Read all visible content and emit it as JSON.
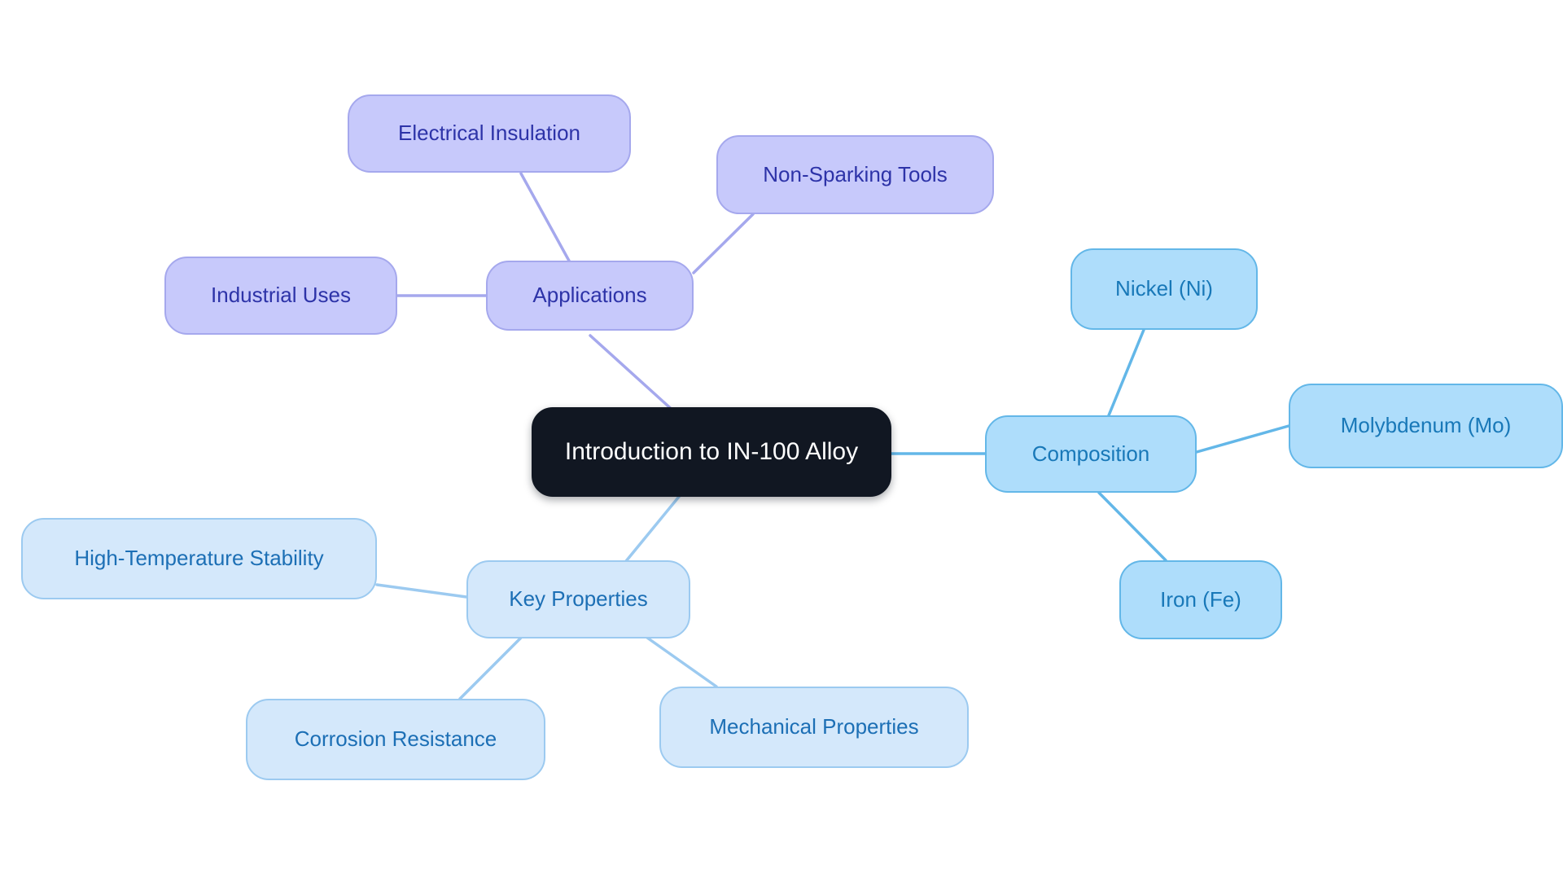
{
  "diagram": {
    "type": "mind-map",
    "title": "Introduction to IN-100 Alloy",
    "background_color": "#ffffff",
    "branch_colors": {
      "applications": "#c7c9fb",
      "composition": "#aeddfb",
      "key_properties": "#d4e8fb",
      "root": "#111722"
    }
  },
  "nodes": {
    "root": {
      "label": "Introduction to IN-100 Alloy"
    },
    "applications": {
      "label": "Applications"
    },
    "electrical_insulation": {
      "label": "Electrical Insulation"
    },
    "non_sparking_tools": {
      "label": "Non-Sparking Tools"
    },
    "industrial_uses": {
      "label": "Industrial Uses"
    },
    "composition": {
      "label": "Composition"
    },
    "nickel": {
      "label": "Nickel (Ni)"
    },
    "molybdenum": {
      "label": "Molybdenum (Mo)"
    },
    "iron": {
      "label": "Iron (Fe)"
    },
    "key_properties": {
      "label": "Key Properties"
    },
    "high_temperature_stability": {
      "label": "High-Temperature Stability"
    },
    "corrosion_resistance": {
      "label": "Corrosion Resistance"
    },
    "mechanical_properties": {
      "label": "Mechanical Properties"
    }
  },
  "edges": [
    {
      "from": "root",
      "to": "applications",
      "color": "#a5a8ed"
    },
    {
      "from": "applications",
      "to": "electrical_insulation",
      "color": "#a5a8ed"
    },
    {
      "from": "applications",
      "to": "non_sparking_tools",
      "color": "#a5a8ed"
    },
    {
      "from": "applications",
      "to": "industrial_uses",
      "color": "#a5a8ed"
    },
    {
      "from": "root",
      "to": "composition",
      "color": "#63b7e8"
    },
    {
      "from": "composition",
      "to": "nickel",
      "color": "#63b7e8"
    },
    {
      "from": "composition",
      "to": "molybdenum",
      "color": "#63b7e8"
    },
    {
      "from": "composition",
      "to": "iron",
      "color": "#63b7e8"
    },
    {
      "from": "root",
      "to": "key_properties",
      "color": "#9ccaf0"
    },
    {
      "from": "key_properties",
      "to": "high_temperature_stability",
      "color": "#9ccaf0"
    },
    {
      "from": "key_properties",
      "to": "corrosion_resistance",
      "color": "#9ccaf0"
    },
    {
      "from": "key_properties",
      "to": "mechanical_properties",
      "color": "#9ccaf0"
    }
  ]
}
